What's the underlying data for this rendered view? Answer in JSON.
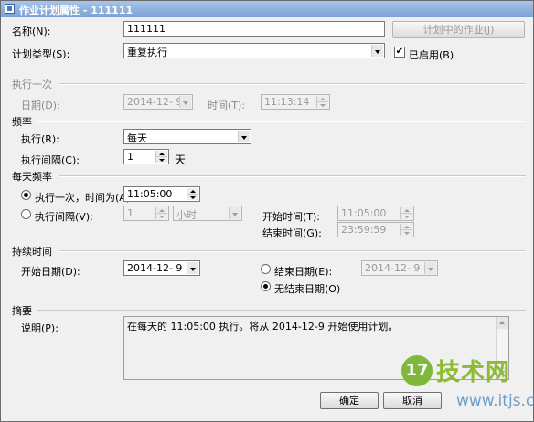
{
  "window": {
    "title": "作业计划属性 - 111111"
  },
  "name": {
    "label": "名称(N):",
    "value": "111111"
  },
  "jobs_in_schedule_button": "计划中的作业(J)",
  "schedule_type": {
    "label": "计划类型(S):",
    "value": "重复执行"
  },
  "enabled": {
    "label": "已启用(B)",
    "checked": true
  },
  "one_time": {
    "section": "执行一次",
    "date_label": "日期(D):",
    "date_value": "2014-12- 9",
    "time_label": "时间(T):",
    "time_value": "11:13:14"
  },
  "frequency": {
    "section": "频率",
    "occurs_label": "执行(R):",
    "occurs_value": "每天",
    "recurs_label": "执行间隔(C):",
    "recurs_value": "1",
    "recurs_unit": "天"
  },
  "daily_frequency": {
    "section": "每天频率",
    "once_label": "执行一次，时间为(A):",
    "once_value": "11:05:00",
    "every_label": "执行间隔(V):",
    "every_value": "1",
    "every_unit": "小时",
    "start_label": "开始时间(T):",
    "start_value": "11:05:00",
    "end_label": "结束时间(G):",
    "end_value": "23:59:59"
  },
  "duration": {
    "section": "持续时间",
    "start_date_label": "开始日期(D):",
    "start_date_value": "2014-12- 9",
    "end_date_label": "结束日期(E):",
    "end_date_value": "2014-12- 9",
    "no_end_label": "无结束日期(O)"
  },
  "summary": {
    "section": "摘要",
    "description_label": "说明(P):",
    "description_value": "在每天的 11:05:00 执行。将从 2014-12-9 开始使用计划。"
  },
  "buttons": {
    "ok": "确定",
    "cancel": "取消"
  },
  "watermark": {
    "logo": "17",
    "text": "技术网",
    "url": "www.itjs.cn"
  }
}
